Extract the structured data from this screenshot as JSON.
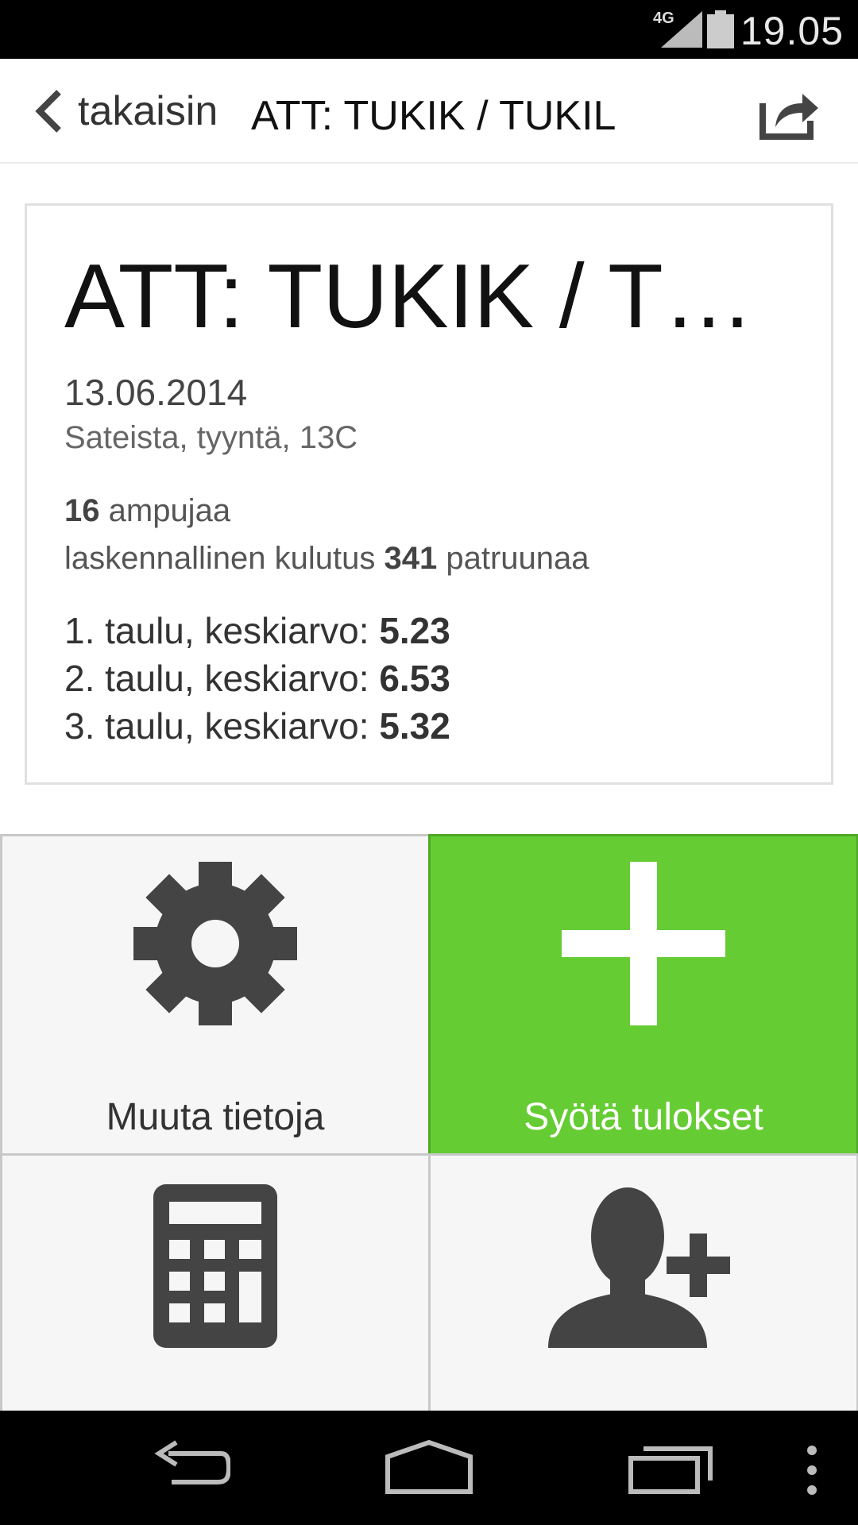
{
  "statusbar": {
    "network": "4G",
    "time": "19.05"
  },
  "header": {
    "back_label": "takaisin",
    "title": "ATT: TUKIK / TUKIL"
  },
  "card": {
    "title": "ATT: TUKIK / TUKIL",
    "date": "13.06.2014",
    "weather": "Sateista, tyyntä, 13C",
    "shooters_count": "16",
    "shooters_label": "ampujaa",
    "consumption_prefix": "laskennallinen kulutus",
    "consumption_value": "341",
    "consumption_unit": "patruunaa",
    "targets": [
      {
        "label": "1. taulu, keskiarvo:",
        "value": "5.23"
      },
      {
        "label": "2. taulu, keskiarvo:",
        "value": "6.53"
      },
      {
        "label": "3. taulu, keskiarvo:",
        "value": "5.32"
      }
    ]
  },
  "tiles": {
    "edit_label": "Muuta tietoja",
    "enter_results_label": "Syötä tulokset"
  },
  "colors": {
    "accent_green": "#66cc33",
    "icon_dark": "#444444"
  },
  "icons": {
    "back": "chevron-left-icon",
    "share": "share-icon",
    "settings": "gear-icon",
    "add": "plus-icon",
    "calculator": "calculator-icon",
    "add_person": "add-person-icon"
  }
}
